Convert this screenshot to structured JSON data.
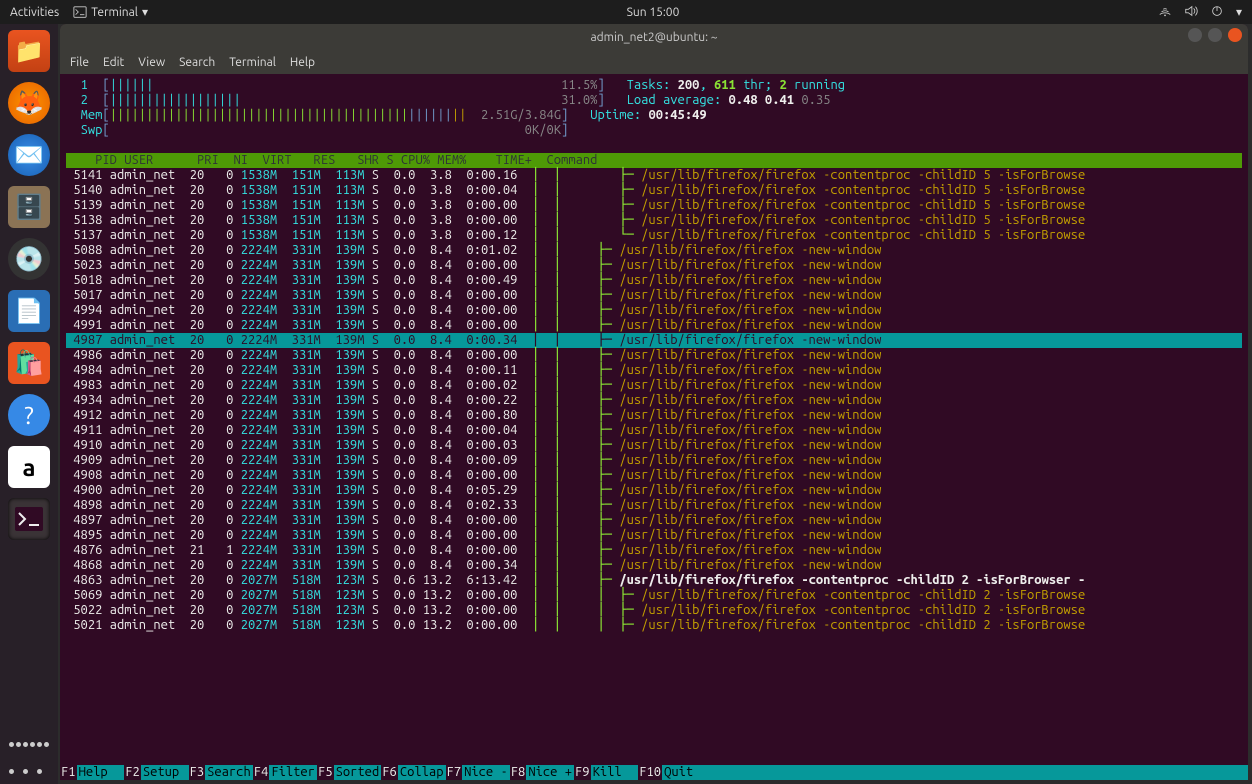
{
  "topbar": {
    "activities": "Activities",
    "app": "Terminal",
    "clock": "Sun 15:00"
  },
  "dock_items": [
    "files-icon",
    "firefox-icon",
    "thunderbird-icon",
    "archive-icon",
    "disks-icon",
    "writer-icon",
    "software-icon",
    "help-icon",
    "amazon-icon",
    "terminal-icon"
  ],
  "window": {
    "title": "admin_net2@ubuntu: ~"
  },
  "menubar": [
    "File",
    "Edit",
    "View",
    "Search",
    "Terminal",
    "Help"
  ],
  "meters": {
    "cpu": [
      {
        "id": "1",
        "pct": "11.5%"
      },
      {
        "id": "2",
        "pct": "31.0%"
      }
    ],
    "mem": {
      "label": "Mem",
      "usage": "2.51G/3.84G"
    },
    "swp": {
      "label": "Swp",
      "usage": "0K/0K"
    }
  },
  "summary": {
    "tasks_label": "Tasks:",
    "tasks": "200",
    "thr_sep": ", ",
    "thr": "611",
    "thr_label": " thr;",
    "running": "2",
    "running_label": " running",
    "load_label": "Load average:",
    "load": [
      "0.48",
      "0.41",
      "0.35"
    ],
    "uptime_label": "Uptime:",
    "uptime": "00:45:49"
  },
  "columns": [
    "PID",
    "USER",
    "PRI",
    "NI",
    "VIRT",
    "RES",
    "SHR",
    "S",
    "CPU%",
    "MEM%",
    "TIME+",
    "Command"
  ],
  "selected_pid": "4987",
  "processes": [
    {
      "pid": "5141",
      "user": "admin_net",
      "pri": "20",
      "ni": "0",
      "virt": "1538M",
      "res": "151M",
      "shr": "113M",
      "s": "S",
      "cpu": "0.0",
      "mem": "3.8",
      "time": "0:00.16",
      "tree": "│  │        ├─ ",
      "cmd": "/usr/lib/firefox/firefox -contentproc -childID 5 -isForBrowse"
    },
    {
      "pid": "5140",
      "user": "admin_net",
      "pri": "20",
      "ni": "0",
      "virt": "1538M",
      "res": "151M",
      "shr": "113M",
      "s": "S",
      "cpu": "0.0",
      "mem": "3.8",
      "time": "0:00.04",
      "tree": "│  │        ├─ ",
      "cmd": "/usr/lib/firefox/firefox -contentproc -childID 5 -isForBrowse"
    },
    {
      "pid": "5139",
      "user": "admin_net",
      "pri": "20",
      "ni": "0",
      "virt": "1538M",
      "res": "151M",
      "shr": "113M",
      "s": "S",
      "cpu": "0.0",
      "mem": "3.8",
      "time": "0:00.00",
      "tree": "│  │        ├─ ",
      "cmd": "/usr/lib/firefox/firefox -contentproc -childID 5 -isForBrowse"
    },
    {
      "pid": "5138",
      "user": "admin_net",
      "pri": "20",
      "ni": "0",
      "virt": "1538M",
      "res": "151M",
      "shr": "113M",
      "s": "S",
      "cpu": "0.0",
      "mem": "3.8",
      "time": "0:00.00",
      "tree": "│  │        ├─ ",
      "cmd": "/usr/lib/firefox/firefox -contentproc -childID 5 -isForBrowse"
    },
    {
      "pid": "5137",
      "user": "admin_net",
      "pri": "20",
      "ni": "0",
      "virt": "1538M",
      "res": "151M",
      "shr": "113M",
      "s": "S",
      "cpu": "0.0",
      "mem": "3.8",
      "time": "0:00.12",
      "tree": "│  │        └─ ",
      "cmd": "/usr/lib/firefox/firefox -contentproc -childID 5 -isForBrowse"
    },
    {
      "pid": "5088",
      "user": "admin_net",
      "pri": "20",
      "ni": "0",
      "virt": "2224M",
      "res": "331M",
      "shr": "139M",
      "s": "S",
      "cpu": "0.0",
      "mem": "8.4",
      "time": "0:01.02",
      "tree": "│  │     ├─ ",
      "cmd": "/usr/lib/firefox/firefox -new-window"
    },
    {
      "pid": "5023",
      "user": "admin_net",
      "pri": "20",
      "ni": "0",
      "virt": "2224M",
      "res": "331M",
      "shr": "139M",
      "s": "S",
      "cpu": "0.0",
      "mem": "8.4",
      "time": "0:00.00",
      "tree": "│  │     ├─ ",
      "cmd": "/usr/lib/firefox/firefox -new-window"
    },
    {
      "pid": "5018",
      "user": "admin_net",
      "pri": "20",
      "ni": "0",
      "virt": "2224M",
      "res": "331M",
      "shr": "139M",
      "s": "S",
      "cpu": "0.0",
      "mem": "8.4",
      "time": "0:00.49",
      "tree": "│  │     ├─ ",
      "cmd": "/usr/lib/firefox/firefox -new-window"
    },
    {
      "pid": "5017",
      "user": "admin_net",
      "pri": "20",
      "ni": "0",
      "virt": "2224M",
      "res": "331M",
      "shr": "139M",
      "s": "S",
      "cpu": "0.0",
      "mem": "8.4",
      "time": "0:00.00",
      "tree": "│  │     ├─ ",
      "cmd": "/usr/lib/firefox/firefox -new-window"
    },
    {
      "pid": "4994",
      "user": "admin_net",
      "pri": "20",
      "ni": "0",
      "virt": "2224M",
      "res": "331M",
      "shr": "139M",
      "s": "S",
      "cpu": "0.0",
      "mem": "8.4",
      "time": "0:00.00",
      "tree": "│  │     ├─ ",
      "cmd": "/usr/lib/firefox/firefox -new-window"
    },
    {
      "pid": "4991",
      "user": "admin_net",
      "pri": "20",
      "ni": "0",
      "virt": "2224M",
      "res": "331M",
      "shr": "139M",
      "s": "S",
      "cpu": "0.0",
      "mem": "8.4",
      "time": "0:00.00",
      "tree": "│  │     ├─ ",
      "cmd": "/usr/lib/firefox/firefox -new-window"
    },
    {
      "pid": "4987",
      "user": "admin_net",
      "pri": "20",
      "ni": "0",
      "virt": "2224M",
      "res": "331M",
      "shr": "139M",
      "s": "S",
      "cpu": "0.0",
      "mem": "8.4",
      "time": "0:00.34",
      "tree": "│  │     ├─ ",
      "cmd": "/usr/lib/firefox/firefox -new-window"
    },
    {
      "pid": "4986",
      "user": "admin_net",
      "pri": "20",
      "ni": "0",
      "virt": "2224M",
      "res": "331M",
      "shr": "139M",
      "s": "S",
      "cpu": "0.0",
      "mem": "8.4",
      "time": "0:00.00",
      "tree": "│  │     ├─ ",
      "cmd": "/usr/lib/firefox/firefox -new-window"
    },
    {
      "pid": "4984",
      "user": "admin_net",
      "pri": "20",
      "ni": "0",
      "virt": "2224M",
      "res": "331M",
      "shr": "139M",
      "s": "S",
      "cpu": "0.0",
      "mem": "8.4",
      "time": "0:00.11",
      "tree": "│  │     ├─ ",
      "cmd": "/usr/lib/firefox/firefox -new-window"
    },
    {
      "pid": "4983",
      "user": "admin_net",
      "pri": "20",
      "ni": "0",
      "virt": "2224M",
      "res": "331M",
      "shr": "139M",
      "s": "S",
      "cpu": "0.0",
      "mem": "8.4",
      "time": "0:00.02",
      "tree": "│  │     ├─ ",
      "cmd": "/usr/lib/firefox/firefox -new-window"
    },
    {
      "pid": "4934",
      "user": "admin_net",
      "pri": "20",
      "ni": "0",
      "virt": "2224M",
      "res": "331M",
      "shr": "139M",
      "s": "S",
      "cpu": "0.0",
      "mem": "8.4",
      "time": "0:00.22",
      "tree": "│  │     ├─ ",
      "cmd": "/usr/lib/firefox/firefox -new-window"
    },
    {
      "pid": "4912",
      "user": "admin_net",
      "pri": "20",
      "ni": "0",
      "virt": "2224M",
      "res": "331M",
      "shr": "139M",
      "s": "S",
      "cpu": "0.0",
      "mem": "8.4",
      "time": "0:00.80",
      "tree": "│  │     ├─ ",
      "cmd": "/usr/lib/firefox/firefox -new-window"
    },
    {
      "pid": "4911",
      "user": "admin_net",
      "pri": "20",
      "ni": "0",
      "virt": "2224M",
      "res": "331M",
      "shr": "139M",
      "s": "S",
      "cpu": "0.0",
      "mem": "8.4",
      "time": "0:00.04",
      "tree": "│  │     ├─ ",
      "cmd": "/usr/lib/firefox/firefox -new-window"
    },
    {
      "pid": "4910",
      "user": "admin_net",
      "pri": "20",
      "ni": "0",
      "virt": "2224M",
      "res": "331M",
      "shr": "139M",
      "s": "S",
      "cpu": "0.0",
      "mem": "8.4",
      "time": "0:00.03",
      "tree": "│  │     ├─ ",
      "cmd": "/usr/lib/firefox/firefox -new-window"
    },
    {
      "pid": "4909",
      "user": "admin_net",
      "pri": "20",
      "ni": "0",
      "virt": "2224M",
      "res": "331M",
      "shr": "139M",
      "s": "S",
      "cpu": "0.0",
      "mem": "8.4",
      "time": "0:00.09",
      "tree": "│  │     ├─ ",
      "cmd": "/usr/lib/firefox/firefox -new-window"
    },
    {
      "pid": "4908",
      "user": "admin_net",
      "pri": "20",
      "ni": "0",
      "virt": "2224M",
      "res": "331M",
      "shr": "139M",
      "s": "S",
      "cpu": "0.0",
      "mem": "8.4",
      "time": "0:00.00",
      "tree": "│  │     ├─ ",
      "cmd": "/usr/lib/firefox/firefox -new-window"
    },
    {
      "pid": "4900",
      "user": "admin_net",
      "pri": "20",
      "ni": "0",
      "virt": "2224M",
      "res": "331M",
      "shr": "139M",
      "s": "S",
      "cpu": "0.0",
      "mem": "8.4",
      "time": "0:05.29",
      "tree": "│  │     ├─ ",
      "cmd": "/usr/lib/firefox/firefox -new-window"
    },
    {
      "pid": "4898",
      "user": "admin_net",
      "pri": "20",
      "ni": "0",
      "virt": "2224M",
      "res": "331M",
      "shr": "139M",
      "s": "S",
      "cpu": "0.0",
      "mem": "8.4",
      "time": "0:02.33",
      "tree": "│  │     ├─ ",
      "cmd": "/usr/lib/firefox/firefox -new-window"
    },
    {
      "pid": "4897",
      "user": "admin_net",
      "pri": "20",
      "ni": "0",
      "virt": "2224M",
      "res": "331M",
      "shr": "139M",
      "s": "S",
      "cpu": "0.0",
      "mem": "8.4",
      "time": "0:00.00",
      "tree": "│  │     ├─ ",
      "cmd": "/usr/lib/firefox/firefox -new-window"
    },
    {
      "pid": "4895",
      "user": "admin_net",
      "pri": "20",
      "ni": "0",
      "virt": "2224M",
      "res": "331M",
      "shr": "139M",
      "s": "S",
      "cpu": "0.0",
      "mem": "8.4",
      "time": "0:00.00",
      "tree": "│  │     ├─ ",
      "cmd": "/usr/lib/firefox/firefox -new-window"
    },
    {
      "pid": "4876",
      "user": "admin_net",
      "pri": "21",
      "ni": "1",
      "virt": "2224M",
      "res": "331M",
      "shr": "139M",
      "s": "S",
      "cpu": "0.0",
      "mem": "8.4",
      "time": "0:00.00",
      "tree": "│  │     ├─ ",
      "cmd": "/usr/lib/firefox/firefox -new-window"
    },
    {
      "pid": "4868",
      "user": "admin_net",
      "pri": "20",
      "ni": "0",
      "virt": "2224M",
      "res": "331M",
      "shr": "139M",
      "s": "S",
      "cpu": "0.0",
      "mem": "8.4",
      "time": "0:00.34",
      "tree": "│  │     ├─ ",
      "cmd": "/usr/lib/firefox/firefox -new-window"
    },
    {
      "pid": "4863",
      "user": "admin_net",
      "pri": "20",
      "ni": "0",
      "virt": "2027M",
      "res": "518M",
      "shr": "123M",
      "s": "S",
      "cpu": "0.6",
      "mem": "13.2",
      "time": "6:13.42",
      "tree": "│  │     ├─ ",
      "cmd": "/usr/lib/firefox/firefox -contentproc -childID 2 -isForBrowser -",
      "bold": true
    },
    {
      "pid": "5069",
      "user": "admin_net",
      "pri": "20",
      "ni": "0",
      "virt": "2027M",
      "res": "518M",
      "shr": "123M",
      "s": "S",
      "cpu": "0.0",
      "mem": "13.2",
      "time": "0:00.00",
      "tree": "│  │     │  ├─ ",
      "cmd": "/usr/lib/firefox/firefox -contentproc -childID 2 -isForBrowse"
    },
    {
      "pid": "5022",
      "user": "admin_net",
      "pri": "20",
      "ni": "0",
      "virt": "2027M",
      "res": "518M",
      "shr": "123M",
      "s": "S",
      "cpu": "0.0",
      "mem": "13.2",
      "time": "0:00.00",
      "tree": "│  │     │  ├─ ",
      "cmd": "/usr/lib/firefox/firefox -contentproc -childID 2 -isForBrowse"
    },
    {
      "pid": "5021",
      "user": "admin_net",
      "pri": "20",
      "ni": "0",
      "virt": "2027M",
      "res": "518M",
      "shr": "123M",
      "s": "S",
      "cpu": "0.0",
      "mem": "13.2",
      "time": "0:00.00",
      "tree": "│  │     │  ├─ ",
      "cmd": "/usr/lib/firefox/firefox -contentproc -childID 2 -isForBrowse"
    }
  ],
  "fnkeys": [
    {
      "k": "F1",
      "l": "Help  "
    },
    {
      "k": "F2",
      "l": "Setup "
    },
    {
      "k": "F3",
      "l": "Search"
    },
    {
      "k": "F4",
      "l": "Filter"
    },
    {
      "k": "F5",
      "l": "Sorted"
    },
    {
      "k": "F6",
      "l": "Collap"
    },
    {
      "k": "F7",
      "l": "Nice -"
    },
    {
      "k": "F8",
      "l": "Nice +"
    },
    {
      "k": "F9",
      "l": "Kill  "
    },
    {
      "k": "F10",
      "l": "Quit  "
    }
  ]
}
